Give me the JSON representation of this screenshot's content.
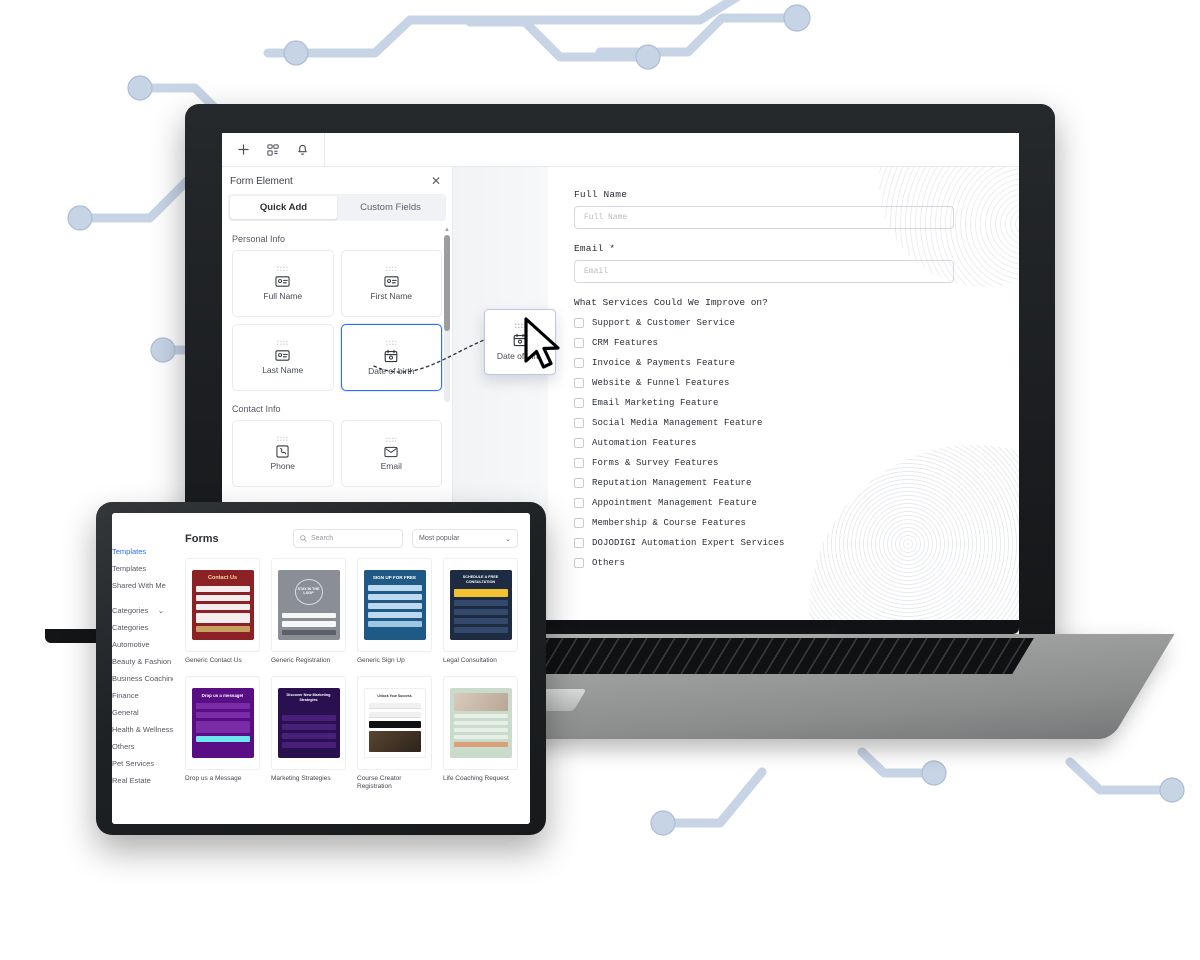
{
  "laptop": {
    "toolbar": {
      "icons": [
        {
          "name": "plus-icon",
          "glyph": "+"
        },
        {
          "name": "workflow-icon",
          "glyph": "⌘"
        },
        {
          "name": "bell-icon",
          "glyph": "⊙"
        }
      ]
    },
    "panel": {
      "title": "Form Element",
      "close_label": "✕",
      "tabs": [
        {
          "label": "Quick Add",
          "active": true
        },
        {
          "label": "Custom Fields",
          "active": false
        }
      ],
      "groups": [
        {
          "title": "Personal Info",
          "items": [
            {
              "label": "Full Name",
              "icon": "id-card-icon",
              "selected": false
            },
            {
              "label": "First Name",
              "icon": "id-card-icon",
              "selected": false
            },
            {
              "label": "Last Name",
              "icon": "id-card-icon",
              "selected": false
            },
            {
              "label": "Date of birth",
              "icon": "calendar-icon",
              "selected": true
            }
          ]
        },
        {
          "title": "Contact Info",
          "items": [
            {
              "label": "Phone",
              "icon": "phone-icon",
              "selected": false
            },
            {
              "label": "Email",
              "icon": "mail-icon",
              "selected": false
            }
          ]
        }
      ]
    },
    "drag_ghost": {
      "label": "Date of birth",
      "icon": "calendar-icon"
    },
    "form": {
      "fields": [
        {
          "label": "Full Name",
          "placeholder": "Full Name",
          "value": ""
        },
        {
          "label": "Email *",
          "placeholder": "Email",
          "value": ""
        }
      ],
      "question": "What Services Could We Improve on?",
      "options": [
        "Support & Customer Service",
        "CRM Features",
        "Invoice & Payments Feature",
        "Website & Funnel Features",
        "Email Marketing Feature",
        "Social Media Management Feature",
        "Automation Features",
        "Forms & Survey Features",
        "Reputation Management Feature",
        "Appointment Management Feature",
        "Membership & Course Features",
        "DOJODIGI Automation Expert Services",
        "Others"
      ]
    }
  },
  "tablet": {
    "sidebar": [
      {
        "label": "Templates",
        "accent": true
      },
      {
        "label": "Templates",
        "accent": false
      },
      {
        "label": "Shared With Me",
        "accent": false
      },
      {
        "label": "Categories",
        "accent": false,
        "chevron": "⌄"
      },
      {
        "label": "Categories",
        "accent": false
      },
      {
        "label": "Automotive",
        "accent": false
      },
      {
        "label": "Beauty & Fashion",
        "accent": false
      },
      {
        "label": "Business Coaching & Consulting",
        "accent": false
      },
      {
        "label": "Finance",
        "accent": false
      },
      {
        "label": "General",
        "accent": false
      },
      {
        "label": "Health & Wellness",
        "accent": false
      },
      {
        "label": "Others",
        "accent": false
      },
      {
        "label": "Pet Services",
        "accent": false
      },
      {
        "label": "Real Estate",
        "accent": false
      }
    ],
    "header": {
      "title": "Forms",
      "search_placeholder": "Search",
      "search_icon": "search-icon",
      "sort_value": "Most popular",
      "sort_chevron": "⌄"
    },
    "templates": [
      {
        "name": "Generic Contact Us",
        "headline": "Contact Us",
        "bg": "#8d2226",
        "accent": "#c9a063",
        "text": "#f0d9a7"
      },
      {
        "name": "Generic Registration",
        "headline": "STAY IN THE LOOP",
        "bg": "#8a8f95",
        "accent": "#5b6067",
        "text": "#ffffff"
      },
      {
        "name": "Generic Sign Up",
        "headline": "SIGN UP FOR FREE",
        "bg": "#1f5a86",
        "accent": "#bcd9ef",
        "text": "#ffffff"
      },
      {
        "name": "Legal Consultation",
        "headline": "SCHEDULE A FREE CONSULTATION",
        "bg": "#1d2c42",
        "accent": "#f2c230",
        "text": "#ffffff"
      },
      {
        "name": "Drop us a Message",
        "headline": "Drop us a message!",
        "bg": "#5a0e85",
        "accent": "#6ee7f0",
        "text": "#ffffff"
      },
      {
        "name": "Marketing Strategies",
        "headline": "Discover New Marketing Strategies",
        "bg": "#2a1050",
        "accent": "#b23fd8",
        "text": "#ffffff"
      },
      {
        "name": "Course Creator Registration",
        "headline": "Unlock Your Success",
        "bg": "#ffffff",
        "accent": "#111111",
        "text": "#333333"
      },
      {
        "name": "Life Coaching Request",
        "headline": "",
        "bg": "#c9dccb",
        "accent": "#d9a07a",
        "text": "#3a4a3c"
      }
    ]
  },
  "branding": {
    "logo_name": "dojodigi-logo"
  },
  "colors": {
    "accent": "#2d6df6",
    "circuit": "#c7d4e6",
    "laptop_body": "#9d9f9e",
    "device_frame": "#1e2124"
  }
}
